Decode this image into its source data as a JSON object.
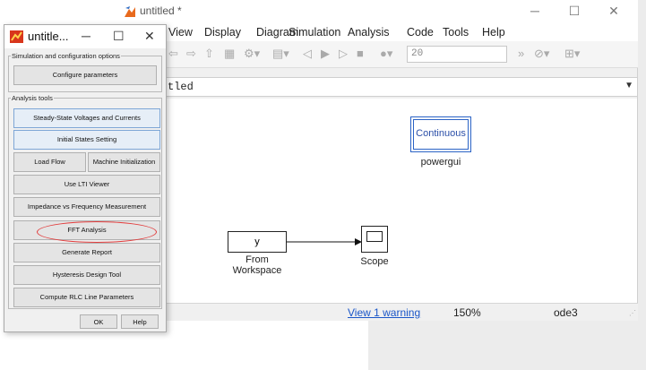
{
  "simulink": {
    "title": "untitled *",
    "menu": [
      "View",
      "Display",
      "Diagram",
      "Simulation",
      "Analysis",
      "Code",
      "Tools",
      "Help"
    ],
    "stop_time": "20",
    "address": "tled",
    "status": {
      "warning": "View 1 warning",
      "zoom": "150%",
      "solver": "ode3"
    },
    "blocks": {
      "powergui": {
        "text": "Continuous",
        "label": "powergui"
      },
      "from_workspace": {
        "text": "y",
        "label_line1": "From",
        "label_line2": "Workspace"
      },
      "scope": {
        "label": "Scope"
      }
    }
  },
  "dialog": {
    "title": "untitle...",
    "group1_title": "Simulation and configuration options",
    "configure_label": "Configure parameters",
    "group2_title": "Analysis tools",
    "buttons": {
      "steady_state": "Steady-State Voltages and Currents",
      "initial_states": "Initial States Setting",
      "load_flow": "Load Flow",
      "machine_init": "Machine Initialization",
      "lti_viewer": "Use LTI Viewer",
      "impedance": "Impedance vs Frequency Measurement",
      "fft": "FFT Analysis",
      "report": "Generate Report",
      "hysteresis": "Hysteresis Design Tool",
      "rlc": "Compute RLC  Line Parameters",
      "ok": "OK",
      "help": "Help"
    }
  },
  "colors": {
    "annotation_ellipse": "#e23c3c",
    "link": "#1a56c8",
    "powergui_border": "#2b63c5"
  }
}
